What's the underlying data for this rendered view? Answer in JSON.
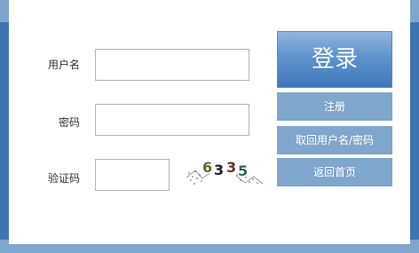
{
  "form": {
    "username_label": "用户名",
    "username_value": "",
    "password_label": "密码",
    "password_value": "",
    "captcha_label": "验证码",
    "captcha_value": "",
    "captcha_image_text": "6335"
  },
  "buttons": {
    "login": "登录",
    "register": "注册",
    "recover": "取回用户名/密码",
    "home": "返回首页"
  },
  "colors": {
    "accent": "#3f74b3",
    "button_light": "#7fa6cc",
    "login_gradient_top": "#8fb5de",
    "login_gradient_bottom": "#3f78bb"
  }
}
